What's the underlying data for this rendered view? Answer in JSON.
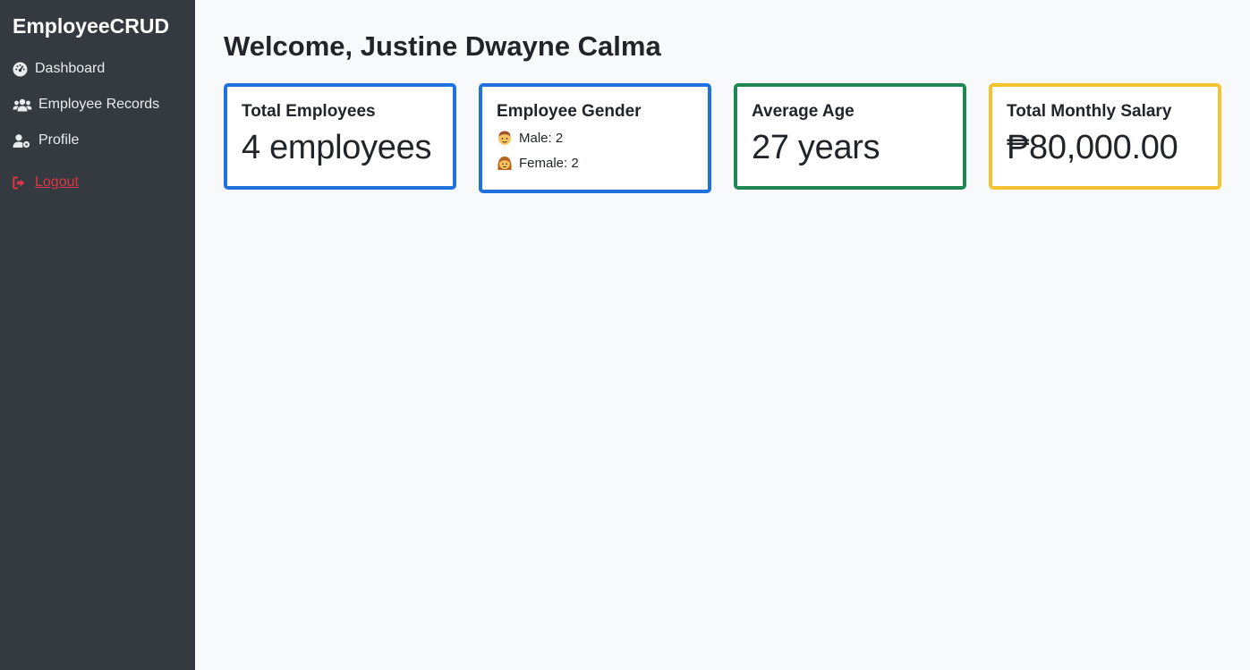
{
  "sidebar": {
    "brand": "EmployeeCRUD",
    "items": [
      {
        "label": "Dashboard",
        "icon": "dashboard-icon"
      },
      {
        "label": "Employee Records",
        "icon": "users-icon"
      },
      {
        "label": "Profile",
        "icon": "user-gear-icon"
      }
    ],
    "logout": {
      "label": "Logout",
      "icon": "sign-out-icon"
    }
  },
  "main": {
    "title": "Welcome, Justine Dwayne Calma",
    "cards": {
      "total_employees": {
        "title": "Total Employees",
        "value": "4 employees"
      },
      "gender": {
        "title": "Employee Gender",
        "male": "Male: 2",
        "female": "Female: 2"
      },
      "average_age": {
        "title": "Average Age",
        "value": "27 years"
      },
      "salary": {
        "title": "Total Monthly Salary",
        "value": "₱80,000.00"
      }
    }
  },
  "colors": {
    "sidebar_bg": "#343a40",
    "card_blue": "#1f72de",
    "card_green": "#1f8752",
    "card_yellow": "#f4c430",
    "logout_red": "#dc3545"
  }
}
